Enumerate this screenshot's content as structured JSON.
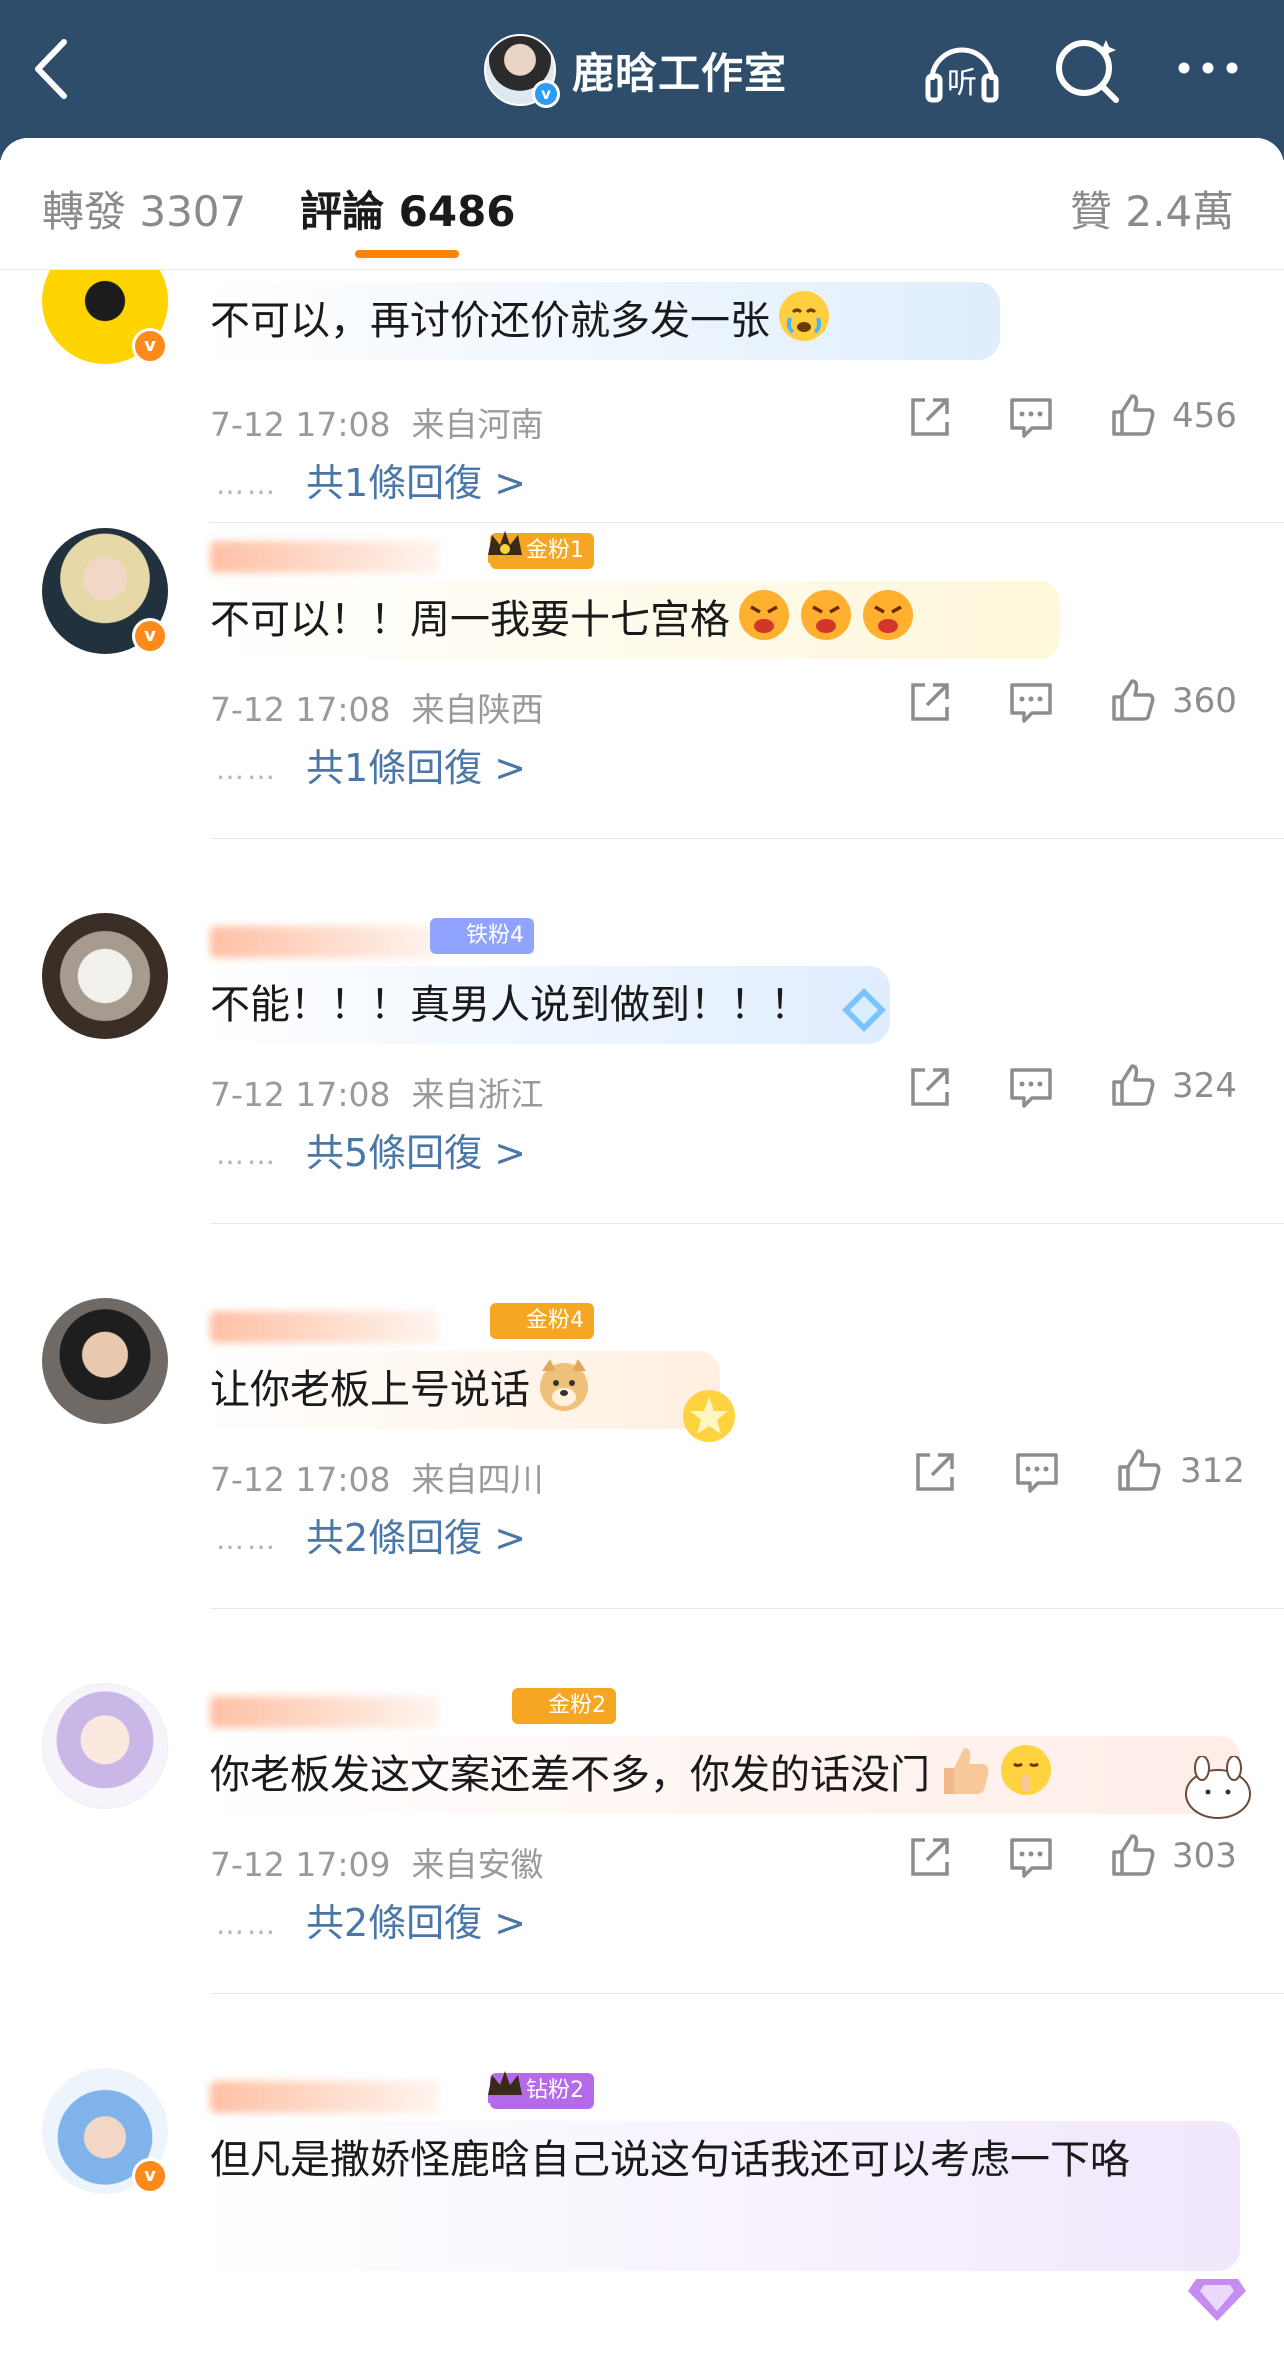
{
  "header": {
    "title": "鹿晗工作室",
    "listen_label": "听",
    "accent": "#2d4d6a"
  },
  "tabs": {
    "repost": "轉發 3307",
    "comments": "評論 6486",
    "likes": "贊 2.4萬",
    "active_color": "#ff8200"
  },
  "comments": [
    {
      "avatar": "yellow-logo-avatar",
      "verified": true,
      "fan_badge": "",
      "text": "不可以，再讨价还价就多发一张",
      "emoji": [
        "crying-emoji"
      ],
      "time": "7-12 17:08",
      "location": "来自河南",
      "likes": "456",
      "replies": "共1條回復 >"
    },
    {
      "avatar": "blonde-person-avatar",
      "verified": true,
      "fan_badge": "金粉1",
      "text": "不可以！！周一我要十七宫格",
      "emoji": [
        "angry-cry-emoji",
        "angry-cry-emoji",
        "angry-cry-emoji"
      ],
      "time": "7-12 17:08",
      "location": "来自陕西",
      "likes": "360",
      "replies": "共1條回復 >"
    },
    {
      "avatar": "rabbit-photo-avatar",
      "verified": false,
      "fan_badge": "铁粉4",
      "text": "不能！！！真男人说到做到！！！",
      "emoji": [],
      "time": "7-12 17:08",
      "location": "来自浙江",
      "likes": "324",
      "replies": "共5條回復 >"
    },
    {
      "avatar": "glasses-person-avatar",
      "verified": false,
      "fan_badge": "金粉4",
      "text": "让你老板上号说话",
      "emoji": [
        "doge-emoji"
      ],
      "time": "7-12 17:08",
      "location": "来自四川",
      "likes": "312",
      "replies": "共2條回復 >"
    },
    {
      "avatar": "anime-girl-avatar",
      "verified": false,
      "fan_badge": "金粉2",
      "text": "你老板发这文案还差不多，你发的话没门",
      "emoji": [
        "thumbs-up-emoji",
        "shush-emoji"
      ],
      "time": "7-12 17:09",
      "location": "来自安徽",
      "likes": "303",
      "replies": "共2條回復 >"
    },
    {
      "avatar": "blue-hat-avatar",
      "verified": true,
      "fan_badge": "钻粉2",
      "text": "但凡是撒娇怪鹿晗自己说这句话我还可以考虑一下咯",
      "emoji": [],
      "time": "",
      "location": "",
      "likes": "",
      "replies": ""
    }
  ],
  "reply_prefix": "……"
}
